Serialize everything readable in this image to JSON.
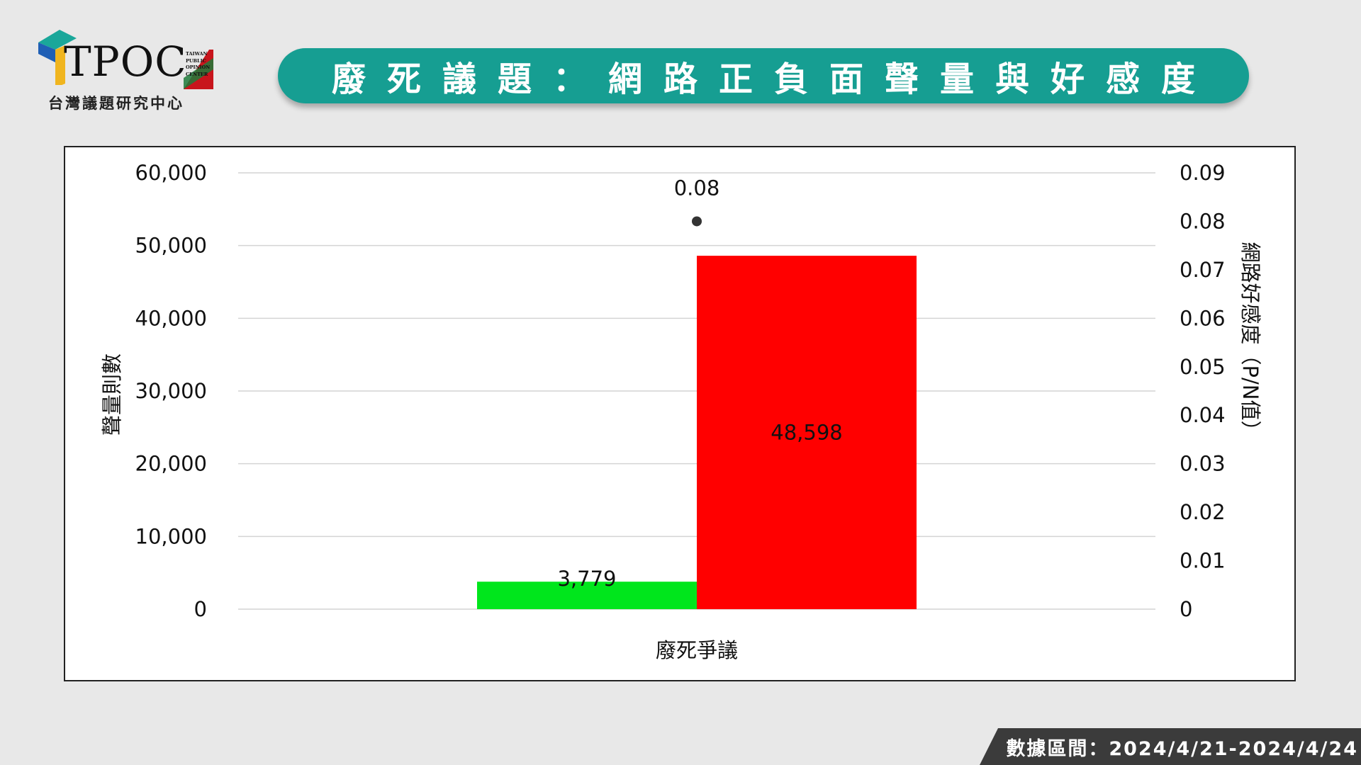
{
  "logo": {
    "wordmark": "TPOC",
    "badge_lines": [
      "TAIWAN",
      "PUBLIC",
      "OPINION",
      "CENTER"
    ],
    "subtitle": "台灣議題研究中心"
  },
  "banner": {
    "title": "廢死議題：網路正負面聲量與好感度"
  },
  "footer": {
    "date_range": "數據區間：2024/4/21-2024/4/24"
  },
  "colors": {
    "banner": "#169e92",
    "positive_bar": "#00e61c",
    "negative_bar": "#ff0000",
    "ratio_point": "#333333",
    "footer": "#3b3b3b"
  },
  "chart_data": {
    "type": "bar",
    "categories": [
      "廢死爭議"
    ],
    "series": [
      {
        "values": [
          3779
        ],
        "value_labels": [
          "3,779"
        ],
        "color": "#00e61c",
        "axis": "left"
      },
      {
        "values": [
          48598
        ],
        "value_labels": [
          "48,598"
        ],
        "color": "#ff0000",
        "axis": "left"
      }
    ],
    "ratio_series": {
      "type": "scatter",
      "values": [
        0.08
      ],
      "value_labels": [
        "0.08"
      ],
      "axis": "right"
    },
    "ylabel": "聲量則數",
    "ylim": [
      0,
      60000
    ],
    "yticks": [
      "0",
      "10,000",
      "20,000",
      "30,000",
      "40,000",
      "50,000",
      "60,000"
    ],
    "y2label": "網路好感度（P/N值）",
    "y2lim": [
      0,
      0.09
    ],
    "y2ticks": [
      "0",
      "0.01",
      "0.02",
      "0.03",
      "0.04",
      "0.05",
      "0.06",
      "0.07",
      "0.08",
      "0.09"
    ],
    "grid": true,
    "legend": "none"
  }
}
